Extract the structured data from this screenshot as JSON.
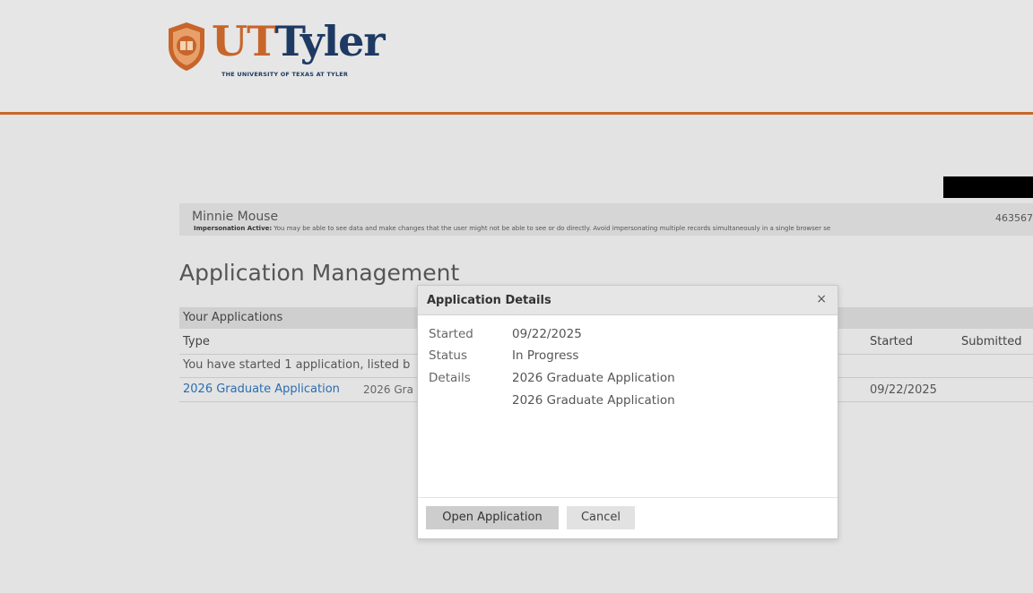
{
  "header": {
    "logo_ut": "UT",
    "logo_tyler": "Tyler",
    "logo_subtitle": "THE UNIVERSITY OF TEXAS AT TYLER",
    "brand_orange": "#c8652a",
    "brand_navy": "#1e3a63"
  },
  "impersonation": {
    "name": "Minnie Mouse",
    "id": "463567",
    "note_label": "Impersonation Active:",
    "note_text": " You may be able to see data and make changes that the user might not be able to see or do directly. Avoid impersonating multiple records simultaneously in a single browser se"
  },
  "page": {
    "title": "Application Management"
  },
  "applications": {
    "section_title": "Your Applications",
    "columns": {
      "type": "Type",
      "started": "Started",
      "submitted": "Submitted"
    },
    "info": "You have started 1 application, listed b",
    "rows": [
      {
        "link": "2026 Graduate Application",
        "type": "2026 Gra",
        "started": "09/22/2025"
      }
    ]
  },
  "modal": {
    "title": "Application Details",
    "close": "×",
    "started_label": "Started",
    "started_value": "09/22/2025",
    "status_label": "Status",
    "status_value": "In Progress",
    "details_label": "Details",
    "details_value_1": "2026 Graduate Application",
    "details_value_2": "2026 Graduate Application",
    "open_button": "Open Application",
    "cancel_button": "Cancel"
  }
}
